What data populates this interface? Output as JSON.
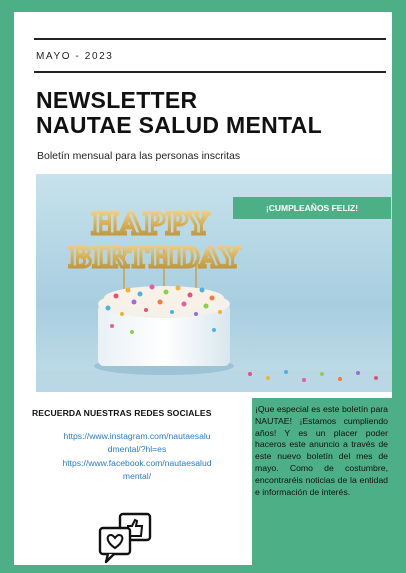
{
  "header": {
    "date": "MAYO - 2023",
    "title_line1": "NEWSLETTER",
    "title_line2": "NAUTAE SALUD MENTAL",
    "subtitle": "Boletín mensual para las personas inscritas"
  },
  "hero": {
    "banner": "¡CUMPLEAÑOS FELIZ!",
    "topper_line1": "HAPPY",
    "topper_line2": "BIRTHDAY"
  },
  "social": {
    "heading": "RECUERDA NUESTRAS REDES SOCIALES",
    "instagram_line1": "https://www.instagram.com/nautaesalu",
    "instagram_line2": "dmental/?hl=es",
    "facebook_line1": "https://www.facebook.com/nautaesalud",
    "facebook_line2": "mental/",
    "icon": "social-media-icon"
  },
  "announcement": {
    "text": "¡Que especial es este boletín para NAUTAE! ¡Estamos cumpliendo años! Y es un placer poder haceros este anuncio a través de este nuevo boletín del mes de mayo. Como de costumbre, encontraréis noticias de la entidad e información de interés."
  },
  "colors": {
    "accent": "#4daf86",
    "link": "#2a7ad6"
  }
}
